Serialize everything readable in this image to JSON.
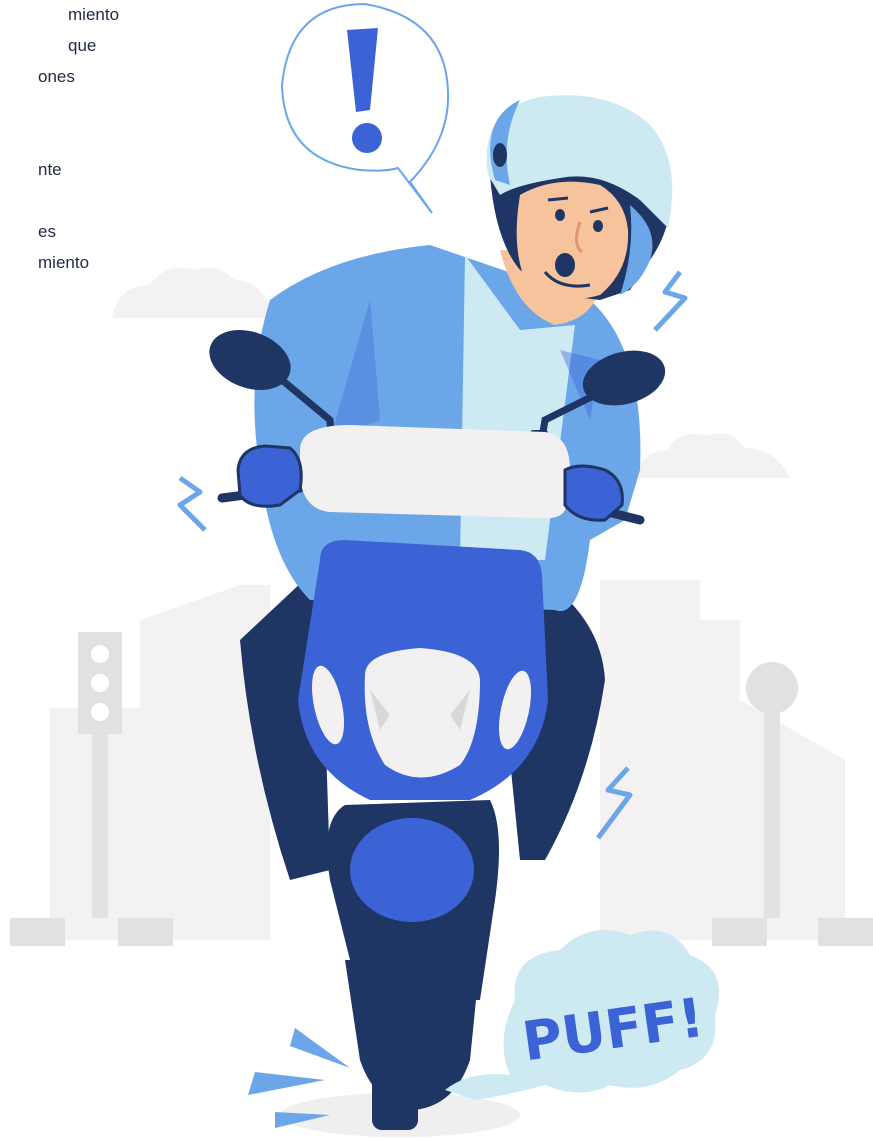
{
  "text_fragment": {
    "lines": [
      "miento",
      "que",
      "ones",
      "nte",
      "es",
      "miento"
    ]
  },
  "illustration": {
    "speech_bubble_symbol": "!",
    "exhaust_label": "PUFF!",
    "colors": {
      "brand_blue": "#3b63d6",
      "sky_blue": "#6aa6e8",
      "navy": "#1f3563",
      "pale_blue": "#cdeaf3",
      "skin": "#f6c39c",
      "background_gray": "#efefef"
    }
  }
}
